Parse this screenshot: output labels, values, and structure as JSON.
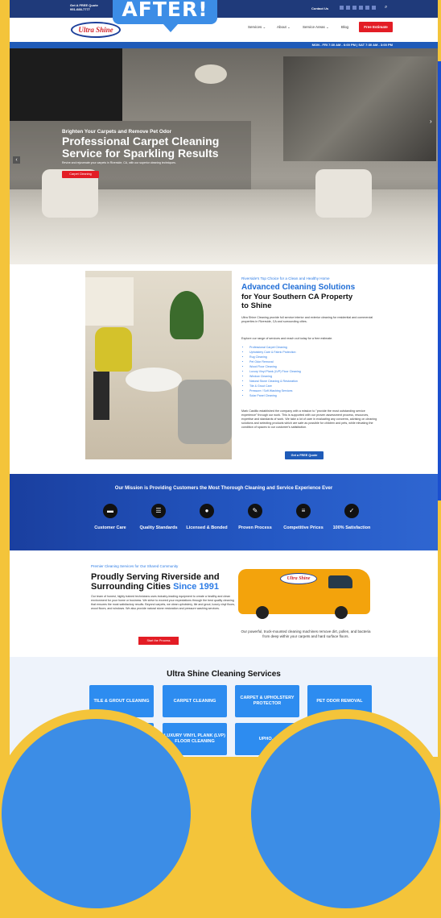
{
  "badge": {
    "label": "AFTER!"
  },
  "topbar": {
    "quote_line1": "Get A FREE Quote",
    "quote_line2": "951-688-7777",
    "contact": "Contact Us"
  },
  "nav": {
    "logo": "Ultra Shine",
    "items": [
      "Services ⌄",
      "About ⌄",
      "Service Areas ⌄",
      "Blog"
    ],
    "cta": "Free Estimate"
  },
  "hours": "MON - FRI 7:30 AM - 6:00 PM  |  SAT 7:30 AM - 3:00 PM",
  "hero": {
    "eyebrow": "Brighten Your Carpets and Remove Pet Odor",
    "title": "Professional Carpet Cleaning Service for Sparkling Results",
    "subtitle": "Revive and rejuvenate your carpets in Riverside, CA, with our superior cleaning techniques.",
    "button": "Carpet Cleaning"
  },
  "about": {
    "eyebrow": "Riverside's Top Choice for a Clean and Healthy Home",
    "title1": "Advanced Cleaning Solutions",
    "title2": "for Your Southern CA Property to Shine",
    "p1": "Ultra Shine Cleaning provide full service interior and exterior cleaning for residential and commercial properties in Riverside, CA and surrounding cities.",
    "p2": "Explore our range of services and reach out today for a free estimate.",
    "list": [
      "Professional Carpet Cleaning",
      "Upholstery Care & Fabric Protection",
      "Rug Cleaning",
      "Pet Odor Removal",
      "Wood Floor Cleaning",
      "Luxury Vinyl Plank (LVP) Floor Cleaning",
      "Window Cleaning",
      "Natural Stone Cleaning & Restoration",
      "Tile & Grout Care",
      "Pressure / Soft Washing Services",
      "Solar Panel Cleaning"
    ],
    "p3": "Mark Castillo established the company with a mission to \"provide the most outstanding service experience\" through our work. This is supported with our proven assessment process, resources, expertise and standards of work. We take a lot of care in evaluating any concerns, advising on cleaning solutions and selecting products which are safe as possible for children and pets, while elevating the condition of spaces to our customer's satisfaction.",
    "button": "Get a FREE Quote"
  },
  "mission": {
    "title": "Our Mission is Providing Customers the Most Thorough Cleaning and Service Experience Ever",
    "items": [
      {
        "icon": "chat-icon",
        "glyph": "▬",
        "label": "Customer Care"
      },
      {
        "icon": "list-icon",
        "glyph": "☰",
        "label": "Quality Standards"
      },
      {
        "icon": "person-icon",
        "glyph": "●",
        "label": "Licensed & Bonded"
      },
      {
        "icon": "edit-icon",
        "glyph": "✎",
        "label": "Proven Process"
      },
      {
        "icon": "menu-icon",
        "glyph": "≡",
        "label": "Competitive Prices"
      },
      {
        "icon": "check-icon",
        "glyph": "✓",
        "label": "100% Satisfaction"
      }
    ]
  },
  "serving": {
    "eyebrow": "Premier Cleaning Services for Our Shared Community",
    "title": "Proudly Serving Riverside and Surrounding Cities",
    "since": "Since 1991",
    "p": "Our team of honest, highly trained technicians uses industry-leading equipment to create a healthy and clean environment for your home or business. We strive to exceed your expectations through the best quality cleaning that ensures the most satisfactory results. Beyond carpets, we clean upholstery, tile and grout, luxury vinyl floors, wood floors, and windows. We also provide natural stone restoration and pressure washing services.",
    "button": "Start the Process",
    "van_logo": "Ultra Shine",
    "caption": "Our powerful, truck-mounted cleaning machines remove dirt, pollen, and bacteria from deep within your carpets and hard surface floors."
  },
  "services": {
    "title": "Ultra Shine Cleaning Services",
    "tiles": [
      "TILE & GROUT CLEANING",
      "CARPET CLEANING",
      "CARPET & UPHOLSTERY PROTECTOR",
      "PET ODOR REMOVAL",
      "",
      "LUXURY VINYL PLANK (LVP) FLOOR CLEANING",
      "UPHO..."
    ]
  },
  "colors": {
    "accent": "#2c7be5",
    "brand_red": "#e31d25",
    "navy": "#1f3a7a",
    "frame_yellow": "#f4c43a"
  }
}
